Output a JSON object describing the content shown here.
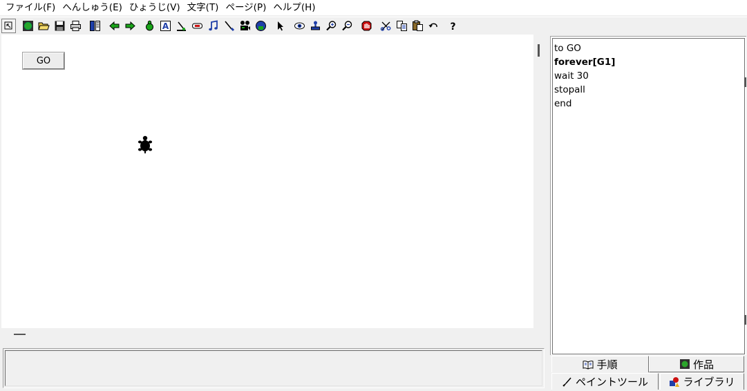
{
  "menubar": {
    "items": [
      "ファイル(F)",
      "へんしゅう(E)",
      "ひょうじ(V)",
      "文字(T)",
      "ページ(P)",
      "ヘルプ(H)"
    ]
  },
  "toolbar": {
    "buttons": [
      {
        "name": "restore-icon"
      },
      {
        "name": "new-project-icon"
      },
      {
        "name": "open-folder-icon"
      },
      {
        "name": "save-icon"
      },
      {
        "name": "print-icon"
      },
      {
        "name": "page-view-icon"
      },
      {
        "name": "previous-page-icon"
      },
      {
        "name": "next-page-icon"
      },
      {
        "name": "new-turtle-icon"
      },
      {
        "name": "text-box-icon"
      },
      {
        "name": "slider-icon"
      },
      {
        "name": "button-icon"
      },
      {
        "name": "music-note-icon"
      },
      {
        "name": "paint-icon"
      },
      {
        "name": "video-icon"
      },
      {
        "name": "record-icon"
      },
      {
        "name": "select-pointer-icon"
      },
      {
        "name": "eye-icon"
      },
      {
        "name": "stamp-icon"
      },
      {
        "name": "zoom-in-icon"
      },
      {
        "name": "zoom-out-icon"
      },
      {
        "name": "stop-hand-icon"
      },
      {
        "name": "cut-icon"
      },
      {
        "name": "copy-icon"
      },
      {
        "name": "paste-icon"
      },
      {
        "name": "undo-icon"
      },
      {
        "name": "help-icon"
      }
    ],
    "colors": {
      "green": "#1a8a1a",
      "blue": "#1f3fa8",
      "red": "#cc1010"
    }
  },
  "canvas": {
    "go_button_label": "GO",
    "turtle_icon": "turtle-icon"
  },
  "procedures": {
    "lines": [
      "to GO",
      "forever[G1]",
      "wait 30",
      "stopall",
      "end"
    ]
  },
  "tabs": {
    "procedures": "手順",
    "works": "作品",
    "paint": "ペイントツール",
    "library": "ライブラリ"
  }
}
